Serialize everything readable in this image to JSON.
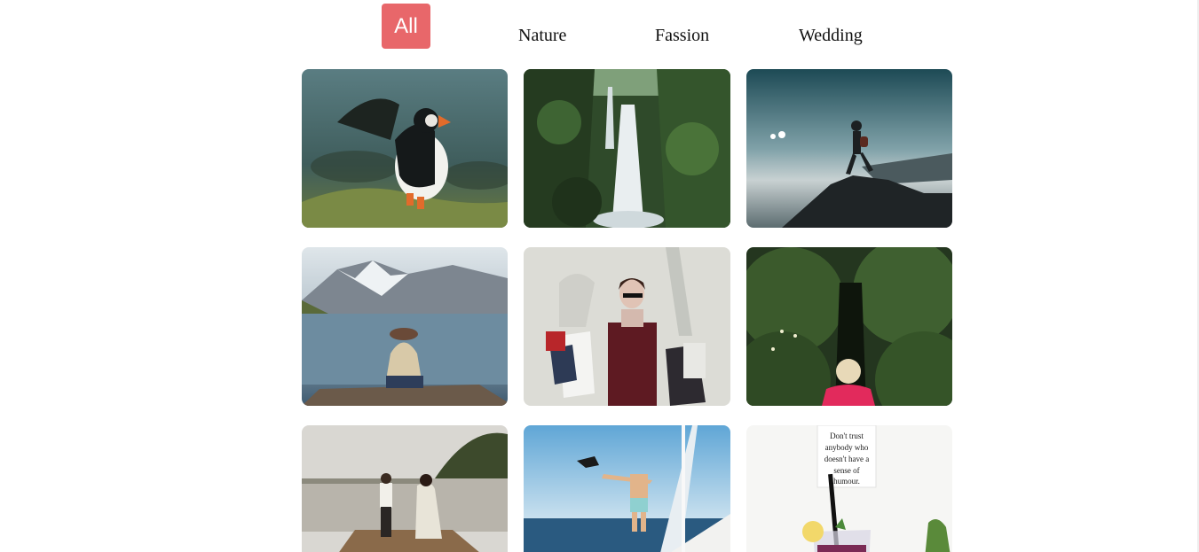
{
  "filters": {
    "all": "All",
    "nature": "Nature",
    "fassion": "Fassion",
    "wedding": "Wedding",
    "active": "All",
    "accent_color": "#e8676a"
  },
  "gallery": {
    "tiles": [
      {
        "subject": "puffin"
      },
      {
        "subject": "waterfall"
      },
      {
        "subject": "hiker-on-rock"
      },
      {
        "subject": "woman-by-lake"
      },
      {
        "subject": "shopping-woman"
      },
      {
        "subject": "child-in-hedge"
      },
      {
        "subject": "couple-on-pier"
      },
      {
        "subject": "man-on-boat"
      },
      {
        "subject": "drink-and-sign"
      }
    ],
    "sign_text": "Don't trust anybody who doesn't have a sense of humour."
  }
}
